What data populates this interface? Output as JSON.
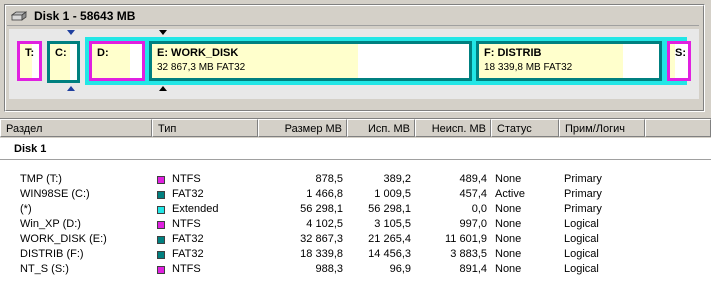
{
  "disk": {
    "title": "Disk 1 - 58643 MB",
    "partitions": [
      {
        "label": "T:",
        "color": "#e020e0"
      },
      {
        "label": "C:",
        "color": "#008080"
      },
      {
        "label": "D:",
        "color": "#e020e0"
      },
      {
        "label": "E:  WORK_DISK",
        "info": "32 867,3 MB    FAT32",
        "color": "#008080"
      },
      {
        "label": "F:  DISTRIB",
        "info": "18 339,8 MB    FAT32",
        "color": "#008080"
      },
      {
        "label": "S:",
        "color": "#e020e0"
      }
    ]
  },
  "table": {
    "columns": [
      "Раздел",
      "Тип",
      "Размер MB",
      "Исп. MB",
      "Неисп. MB",
      "Статус",
      "Прим/Логич"
    ],
    "group": "Disk 1",
    "rows": [
      {
        "name": "TMP (T:)",
        "type": "NTFS",
        "type_color": "#e020e0",
        "size": "878,5",
        "used": "389,2",
        "free": "489,4",
        "status": "None",
        "kind": "Primary"
      },
      {
        "name": "WIN98SE (C:)",
        "type": "FAT32",
        "type_color": "#008080",
        "size": "1 466,8",
        "used": "1 009,5",
        "free": "457,4",
        "status": "Active",
        "kind": "Primary"
      },
      {
        "name": "(*)",
        "type": "Extended",
        "type_color": "#22e6e6",
        "size": "56 298,1",
        "used": "56 298,1",
        "free": "0,0",
        "status": "None",
        "kind": "Primary"
      },
      {
        "name": "Win_XP (D:)",
        "type": "NTFS",
        "type_color": "#e020e0",
        "size": "4 102,5",
        "used": "3 105,5",
        "free": "997,0",
        "status": "None",
        "kind": "Logical"
      },
      {
        "name": "WORK_DISK (E:)",
        "type": "FAT32",
        "type_color": "#008080",
        "size": "32 867,3",
        "used": "21 265,4",
        "free": "11 601,9",
        "status": "None",
        "kind": "Logical"
      },
      {
        "name": "DISTRIB (F:)",
        "type": "FAT32",
        "type_color": "#008080",
        "size": "18 339,8",
        "used": "14 456,3",
        "free": "3 883,5",
        "status": "None",
        "kind": "Logical"
      },
      {
        "name": "NT_S (S:)",
        "type": "NTFS",
        "type_color": "#e020e0",
        "size": "988,3",
        "used": "96,9",
        "free": "891,4",
        "status": "None",
        "kind": "Logical"
      }
    ]
  }
}
